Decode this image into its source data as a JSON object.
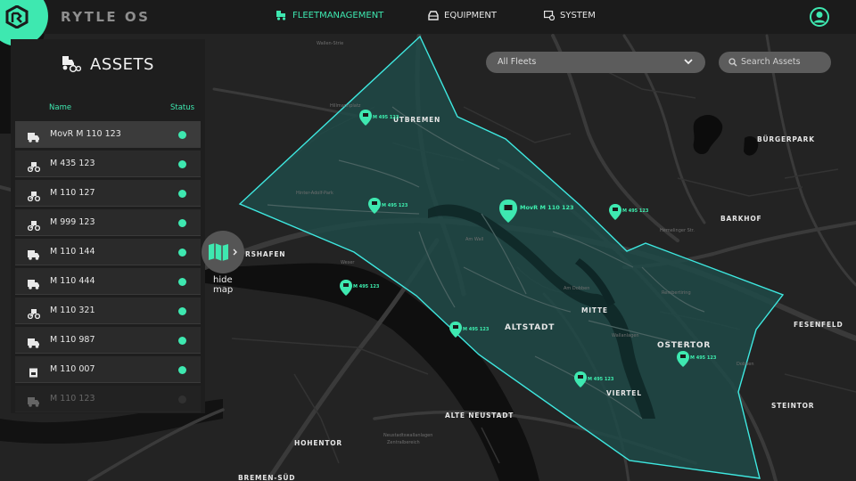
{
  "app": {
    "brand": "RYTLE OS"
  },
  "nav": {
    "fleet": "FLEETMANAGEMENT",
    "equipment": "EQUIPMENT",
    "system": "SYSTEM"
  },
  "colors": {
    "accent": "#3ee8b0",
    "background": "#232323",
    "panel": "#1e1e1e",
    "zone_fill": "#1f4a48",
    "zone_stroke": "#3ee8e0"
  },
  "assets_panel": {
    "title": "ASSETS",
    "col_name": "Name",
    "col_status": "Status",
    "rows": [
      {
        "name": "MovR M 110 123",
        "icon": "truck-icon",
        "status": "online",
        "selected": true
      },
      {
        "name": "M 435 123",
        "icon": "bike-icon",
        "status": "online"
      },
      {
        "name": "M 110 127",
        "icon": "bike-icon",
        "status": "online"
      },
      {
        "name": "M 999 123",
        "icon": "bike-icon",
        "status": "online"
      },
      {
        "name": "M 110 144",
        "icon": "truck-icon",
        "status": "online"
      },
      {
        "name": "M 110 444",
        "icon": "truck-icon",
        "status": "online"
      },
      {
        "name": "M 110 321",
        "icon": "bike-icon",
        "status": "online"
      },
      {
        "name": "M 110 987",
        "icon": "truck-icon",
        "status": "online"
      },
      {
        "name": "M 110 007",
        "icon": "container-icon",
        "status": "online"
      },
      {
        "name": "M 110 123",
        "icon": "truck-icon",
        "status": "offline"
      }
    ]
  },
  "hide_map": {
    "label": "hide map"
  },
  "filters": {
    "fleet_select": "All Fleets",
    "search_placeholder": "Search Assets"
  },
  "map": {
    "districts": {
      "d1": "UTBREMEN",
      "d2": "BÜRGERPARK",
      "d3": "BARKHOF",
      "d4": "RSHAFEN",
      "d5": "ALTSTADT",
      "d6": "MITTE",
      "d7": "OSTERTOR",
      "d8": "FESENFELD",
      "d9": "VIERTEL",
      "d10": "STEINTOR",
      "d11": "ALTE NEUSTADT",
      "d12": "HOHENTOR",
      "d13": "BREMEN-SÜD"
    },
    "streets": {
      "s1": "Wallen-Strie",
      "s2": "Hillmannplatz",
      "s3": "Am Wall",
      "s4": "Wallanlagen",
      "s5": "Neustadtswallanlagen",
      "s6": "Zentralbereich",
      "s7": "Hinter-Adolf-Park",
      "s8": "Hemelinger Str.",
      "s9": "Dobben",
      "s10": "Rembertiring",
      "s11": "Am Dobben",
      "s12": "Weser"
    },
    "markers": {
      "m1": "M 495 123",
      "m2": "M 495 123",
      "m3": "MovR M 110 123",
      "m4": "M 495 123",
      "m5": "M 495 123",
      "m6": "M 495 123",
      "m7": "M 495 123",
      "m8": "M 495 123"
    }
  }
}
